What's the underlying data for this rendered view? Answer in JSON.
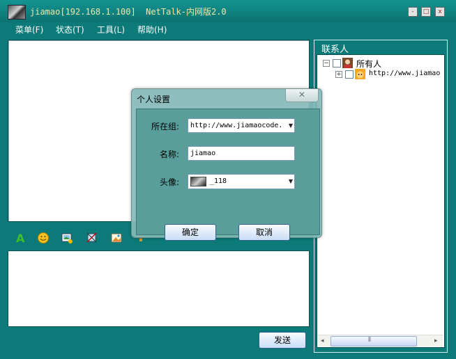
{
  "window": {
    "title": "jiamao[192.168.1.100]  NetTalk-内网版2.0",
    "controls": {
      "minimize": "-",
      "maximize": "□",
      "close": "x"
    }
  },
  "menu": [
    {
      "label": "菜单(F)"
    },
    {
      "label": "状态(T)"
    },
    {
      "label": "工具(L)"
    },
    {
      "label": "帮助(H)"
    }
  ],
  "toolbar": {
    "icons": [
      "font-icon",
      "emoticon-icon",
      "send-image-icon",
      "screenshot-icon",
      "picture-icon",
      "shake-icon"
    ]
  },
  "send_button": "发送",
  "contacts": {
    "title": "联系人",
    "tree": [
      {
        "label": "所有人",
        "expander": "−",
        "icon": "group-avatar-icon"
      },
      {
        "label": "http://www.jiamao",
        "expander": "+",
        "icon": "cat-avatar-icon"
      }
    ],
    "scroll": {
      "left": "◂",
      "right": "▸",
      "grip": "⦀"
    }
  },
  "dialog": {
    "title": "个人设置",
    "close": "✕",
    "group_label": "所在组:",
    "group_value": "http://www.jiamaocode.",
    "name_label": "名称:",
    "name_value": "jiamao",
    "avatar_label": "头像:",
    "avatar_value": "_118",
    "ok": "确定",
    "cancel": "取消"
  },
  "colors": {
    "frame": "#0c7a78",
    "title_text": "#f0e7a8",
    "dialog": "#84bab8"
  }
}
